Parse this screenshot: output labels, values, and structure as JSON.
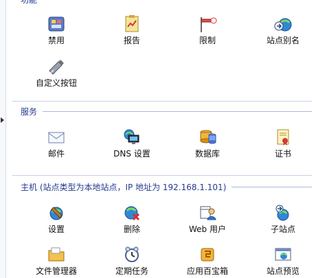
{
  "sections": {
    "partial_title": "功能",
    "services_title": "服务",
    "host_title": "主机 (站点类型为本地站点，IP 地址为 192.168.1.101)"
  },
  "items": {
    "disable": "禁用",
    "report": "报告",
    "limit": "限制",
    "site_alias": "站点别名",
    "custom_buttons": "自定义按钮",
    "mail": "邮件",
    "dns_settings": "DNS 设置",
    "database": "数据库",
    "certificate": "证书",
    "settings": "设置",
    "delete": "删除",
    "web_user": "Web 用户",
    "subsite": "子站点",
    "file_manager": "文件管理器",
    "scheduled_tasks": "定期任务",
    "app_vault": "应用百宝箱",
    "site_preview": "站点预览"
  }
}
